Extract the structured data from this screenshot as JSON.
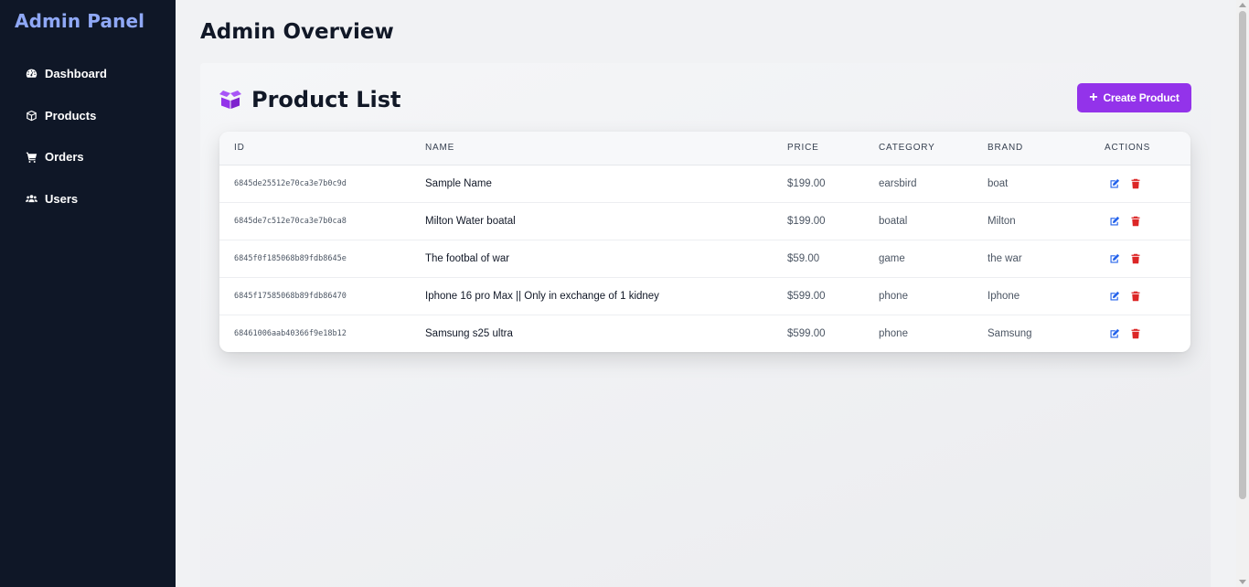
{
  "sidebar": {
    "brand": "Admin Panel",
    "items": [
      {
        "label": "Dashboard",
        "icon": "tachometer-icon"
      },
      {
        "label": "Products",
        "icon": "box-icon"
      },
      {
        "label": "Orders",
        "icon": "cart-icon"
      },
      {
        "label": "Users",
        "icon": "users-icon"
      }
    ]
  },
  "main": {
    "title": "Admin Overview",
    "panel": {
      "title": "Product List",
      "create_button": "Create Product",
      "columns": [
        "ID",
        "NAME",
        "PRICE",
        "CATEGORY",
        "BRAND",
        "ACTIONS"
      ],
      "rows": [
        {
          "id": "6845de25512e70ca3e7b0c9d",
          "name": "Sample Name",
          "price": "$199.00",
          "category": "earsbird",
          "brand": "boat"
        },
        {
          "id": "6845de7c512e70ca3e7b0ca8",
          "name": "Milton Water boatal",
          "price": "$199.00",
          "category": "boatal",
          "brand": "Milton"
        },
        {
          "id": "6845f0f185068b89fdb8645e",
          "name": "The footbal of war",
          "price": "$59.00",
          "category": "game",
          "brand": "the war"
        },
        {
          "id": "6845f17585068b89fdb86470",
          "name": "Iphone 16 pro Max || Only in exchange of 1 kidney",
          "price": "$599.00",
          "category": "phone",
          "brand": "Iphone"
        },
        {
          "id": "68461006aab40366f9e18b12",
          "name": "Samsung s25 ultra",
          "price": "$599.00",
          "category": "phone",
          "brand": "Samsung"
        }
      ]
    }
  },
  "colors": {
    "sidebar_bg": "#0f1727",
    "brand": "#8fa8f6",
    "accent": "#9333ea",
    "edit_icon": "#2563eb",
    "delete_icon": "#dc2626"
  }
}
